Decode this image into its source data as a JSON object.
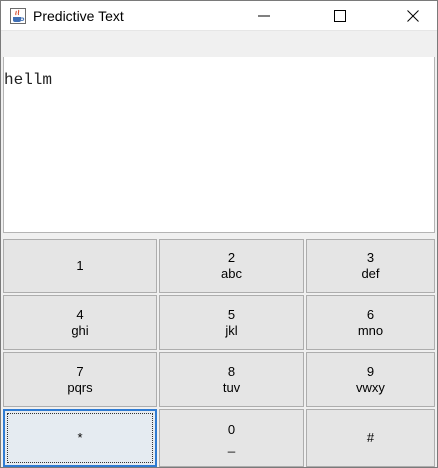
{
  "window": {
    "title": "Predictive Text",
    "icon": "java-cup-icon"
  },
  "text_area": {
    "value": "hellm"
  },
  "keypad": {
    "keys": [
      {
        "num": "1",
        "letters": ""
      },
      {
        "num": "2",
        "letters": "abc"
      },
      {
        "num": "3",
        "letters": "def"
      },
      {
        "num": "4",
        "letters": "ghi"
      },
      {
        "num": "5",
        "letters": "jkl"
      },
      {
        "num": "6",
        "letters": "mno"
      },
      {
        "num": "7",
        "letters": "pqrs"
      },
      {
        "num": "8",
        "letters": "tuv"
      },
      {
        "num": "9",
        "letters": "vwxy"
      },
      {
        "num": "*",
        "letters": ""
      },
      {
        "num": "0",
        "letters": "_"
      },
      {
        "num": "#",
        "letters": ""
      }
    ]
  },
  "colors": {
    "focus_border": "#2f7bd2",
    "key_face": "#e5e5e5"
  }
}
